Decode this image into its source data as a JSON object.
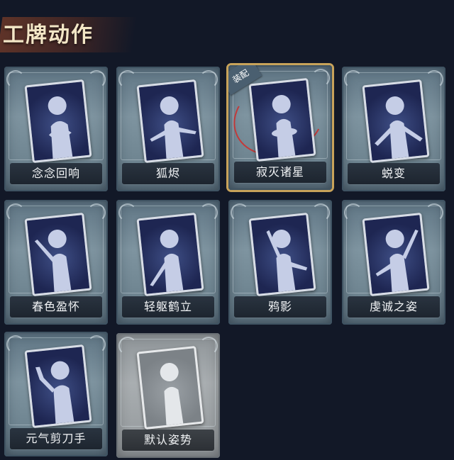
{
  "header": {
    "title": "工牌动作"
  },
  "cards": [
    {
      "label": "念念回响",
      "state": "normal"
    },
    {
      "label": "狐烬",
      "state": "normal"
    },
    {
      "label": "寂灭诸星",
      "state": "equipped",
      "tag": "装配"
    },
    {
      "label": "蜕变",
      "state": "normal"
    },
    {
      "label": "春色盈怀",
      "state": "normal"
    },
    {
      "label": "轻躯鹤立",
      "state": "normal"
    },
    {
      "label": "鸦影",
      "state": "normal"
    },
    {
      "label": "虔诚之姿",
      "state": "normal"
    },
    {
      "label": "元气剪刀手",
      "state": "normal"
    },
    {
      "label": "默认姿势",
      "state": "default"
    }
  ],
  "colors": {
    "accent_gold": "#c8a35a",
    "highlight_red": "#c23a3a"
  }
}
